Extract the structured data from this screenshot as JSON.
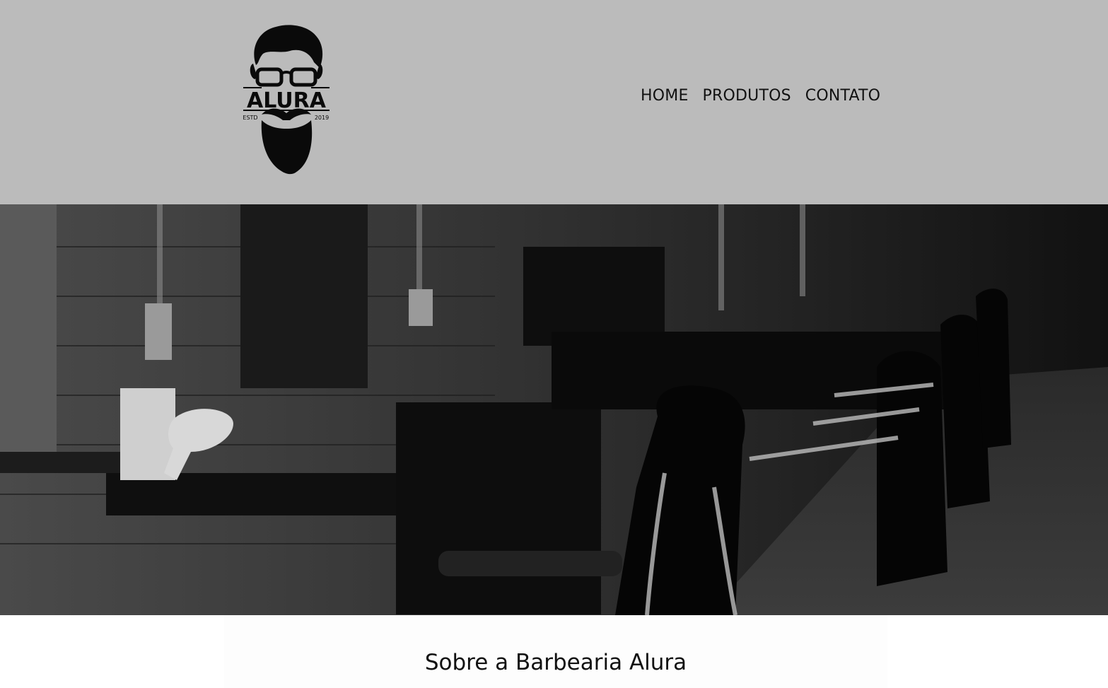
{
  "brand": {
    "name": "ALURA",
    "estd_left": "ESTD",
    "estd_right": "2019"
  },
  "nav": {
    "items": [
      {
        "label": "HOME"
      },
      {
        "label": "PRODUTOS"
      },
      {
        "label": "CONTATO"
      }
    ]
  },
  "hero": {
    "image": "barbershop-interior-photo",
    "colors": {
      "header_bg": "#bbbbbb",
      "hero_bg": "#151515"
    }
  },
  "about": {
    "title": "Sobre a Barbearia Alura"
  }
}
